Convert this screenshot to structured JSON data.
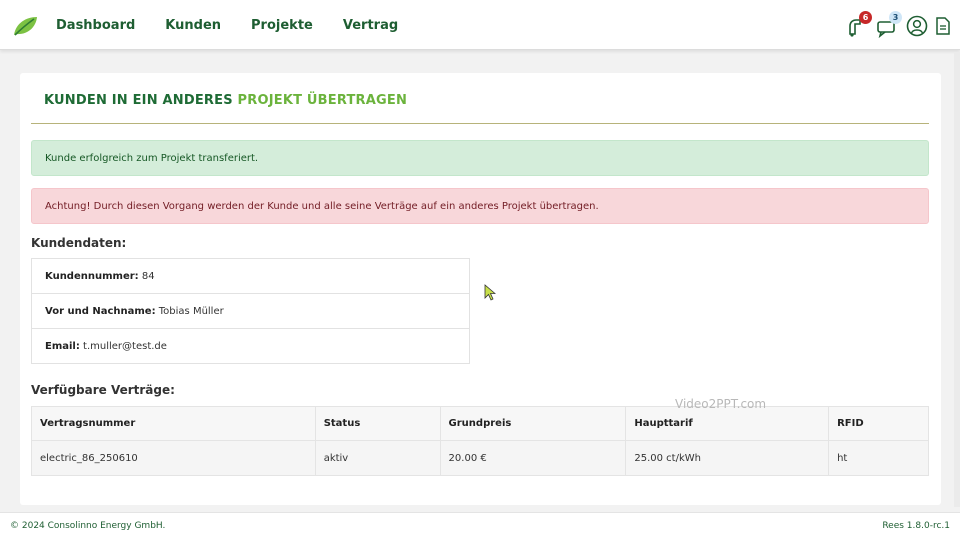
{
  "nav": {
    "items": [
      "Dashboard",
      "Kunden",
      "Projekte",
      "Vertrag"
    ]
  },
  "header_icons": {
    "notifications_count": "6",
    "messages_count": "3"
  },
  "page": {
    "title_part1": "KUNDEN IN EIN ANDERES ",
    "title_part2": "PROJEKT ÜBERTRAGEN"
  },
  "alerts": {
    "success": "Kunde erfolgreich zum Projekt transferiert.",
    "danger": "Achtung! Durch diesen Vorgang werden der Kunde und alle seine Verträge auf ein anderes Projekt übertragen."
  },
  "customer": {
    "heading": "Kundendaten:",
    "number_label": "Kundennummer:",
    "number_value": " 84",
    "name_label": "Vor und Nachname:",
    "name_value": " Tobias Müller",
    "email_label": "Email:",
    "email_value": " t.muller@test.de"
  },
  "contracts": {
    "heading": "Verfügbare Verträge:",
    "columns": [
      "Vertragsnummer",
      "Status",
      "Grundpreis",
      "Haupttarif",
      "RFID"
    ],
    "rows": [
      [
        "electric_86_250610",
        "aktiv",
        "20.00 €",
        "25.00 ct/kWh",
        "ht"
      ]
    ]
  },
  "watermark": "Video2PPT.com",
  "footer": {
    "copyright": "© 2024 Consolinno Energy GmbH.",
    "version": "Rees 1.8.0-rc.1"
  },
  "colors": {
    "brand_dark": "#1e5e32",
    "brand_light": "#6bb33c",
    "success_bg": "#d4edda",
    "danger_bg": "#f8d7da"
  }
}
